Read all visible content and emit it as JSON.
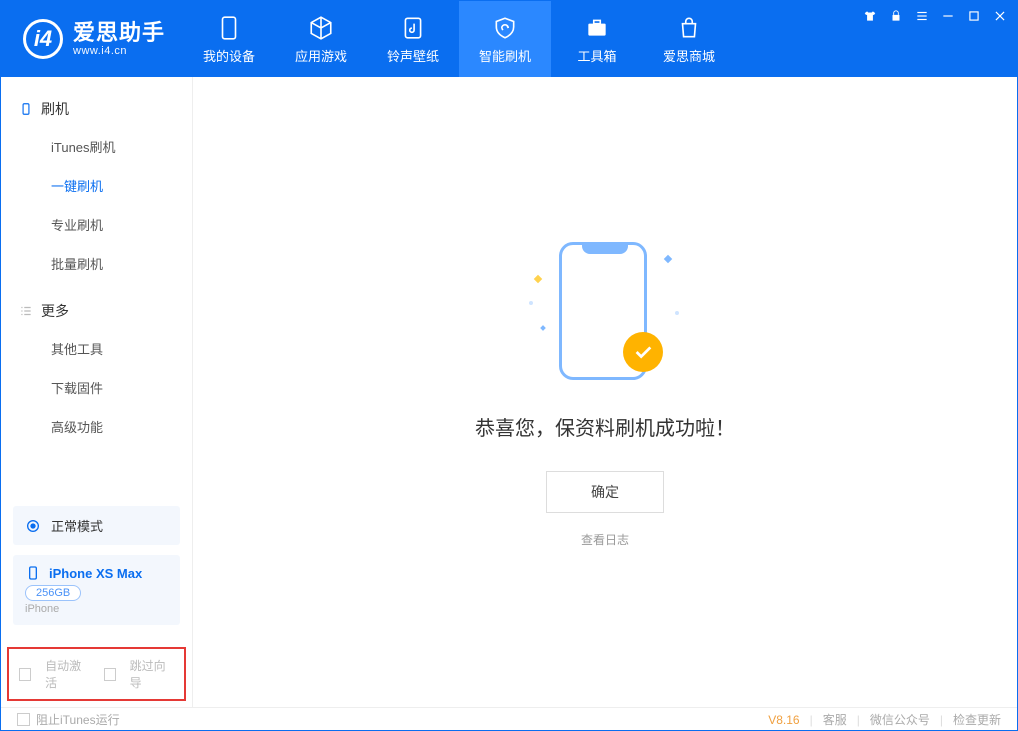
{
  "app": {
    "name_cn": "爱思助手",
    "url": "www.i4.cn"
  },
  "tabs": {
    "device": "我的设备",
    "apps": "应用游戏",
    "ring": "铃声壁纸",
    "flash": "智能刷机",
    "toolbox": "工具箱",
    "store": "爱思商城"
  },
  "sidebar": {
    "group_flash": "刷机",
    "items_flash": {
      "itunes": "iTunes刷机",
      "onekey": "一键刷机",
      "pro": "专业刷机",
      "batch": "批量刷机"
    },
    "group_more": "更多",
    "items_more": {
      "other": "其他工具",
      "firmware": "下载固件",
      "advanced": "高级功能"
    }
  },
  "device_status": {
    "mode": "正常模式",
    "name": "iPhone XS Max",
    "capacity": "256GB",
    "type": "iPhone"
  },
  "checkboxes": {
    "auto_activate": "自动激活",
    "skip_guide": "跳过向导"
  },
  "main": {
    "success_msg": "恭喜您，保资料刷机成功啦！",
    "confirm": "确定",
    "view_log": "查看日志"
  },
  "footer": {
    "block_itunes": "阻止iTunes运行",
    "version": "V8.16",
    "support": "客服",
    "wechat": "微信公众号",
    "update": "检查更新"
  }
}
